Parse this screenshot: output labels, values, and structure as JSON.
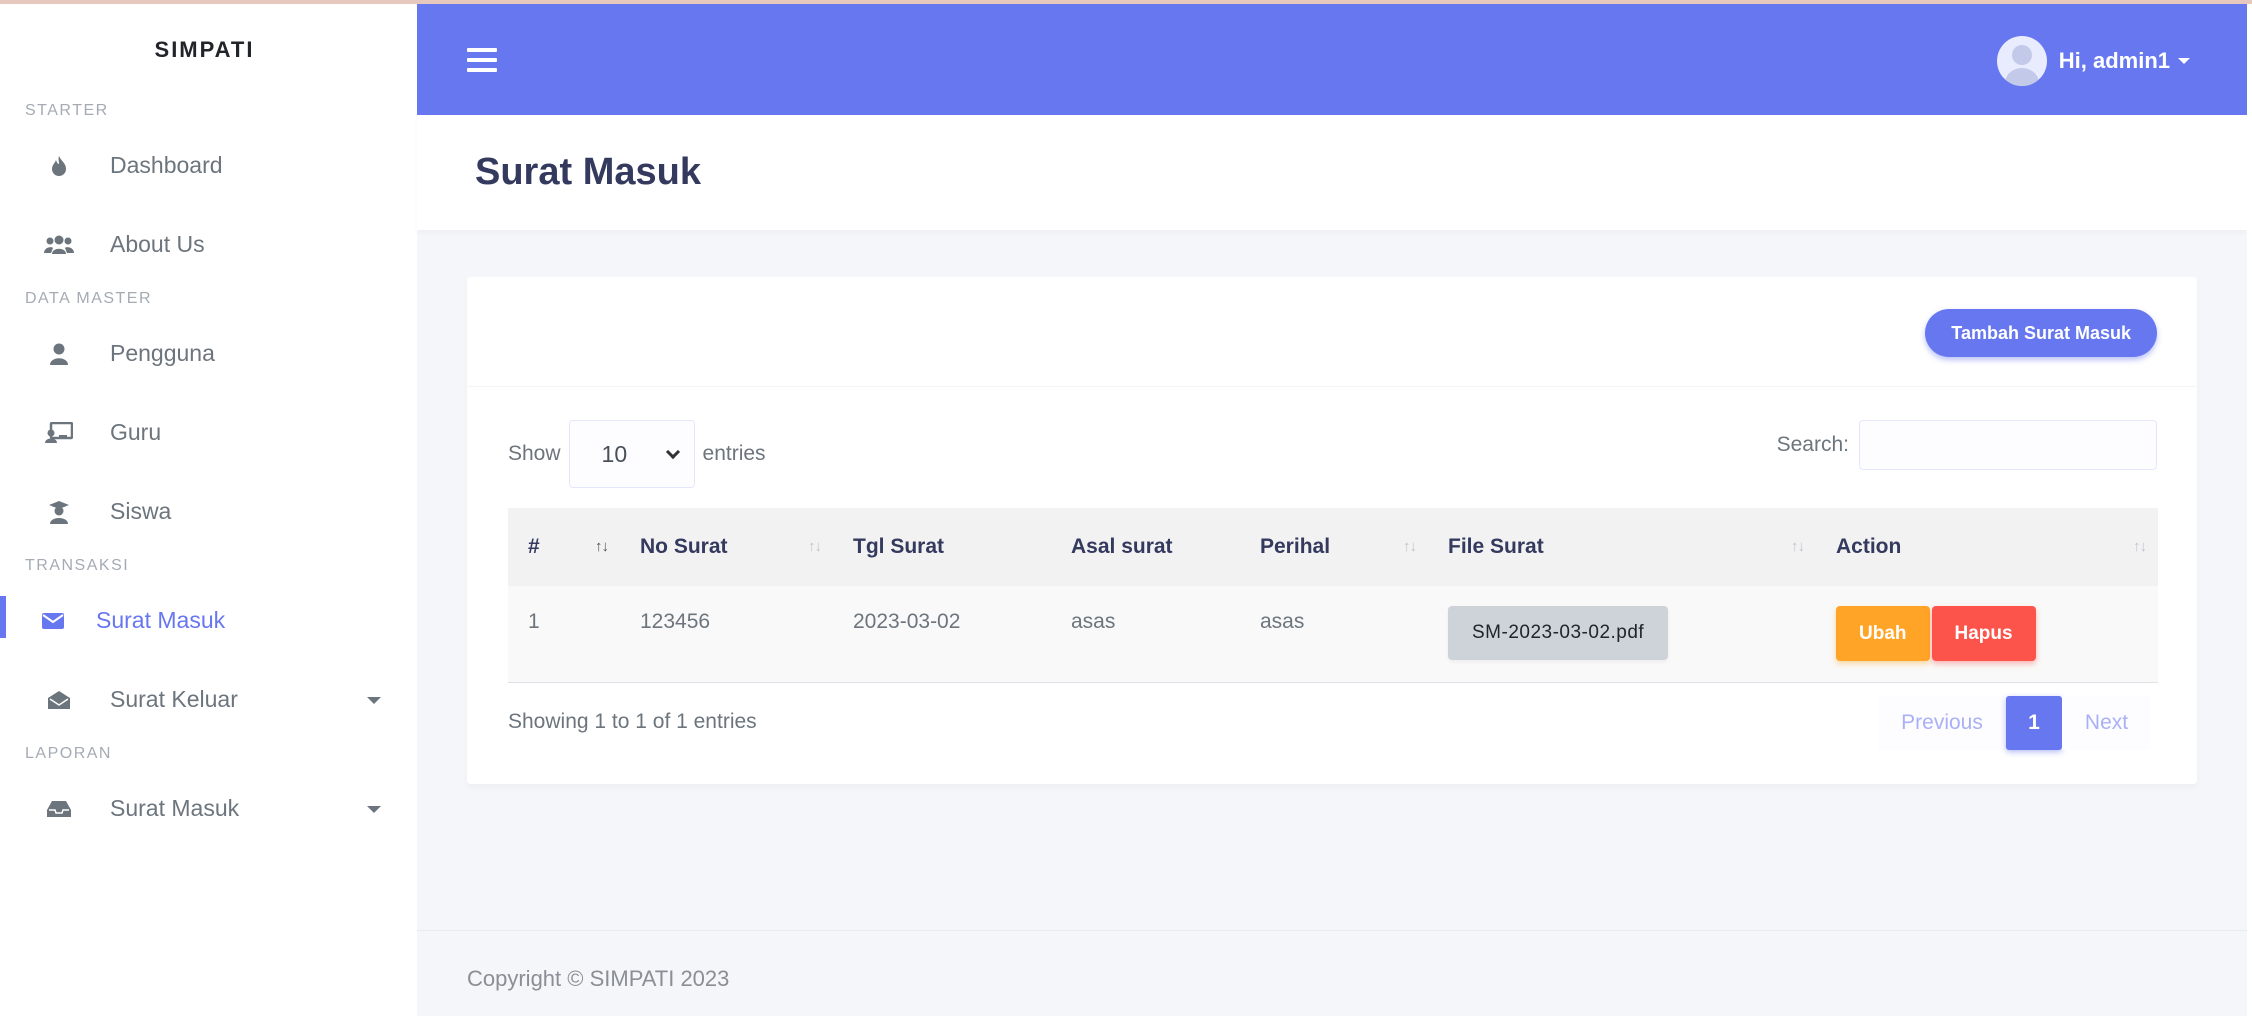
{
  "brand": "SIMPATI",
  "sidebar": {
    "headers": [
      "STARTER",
      "DATA MASTER",
      "TRANSAKSI",
      "LAPORAN"
    ],
    "items": [
      {
        "label": "Dashboard",
        "icon": "fire-icon"
      },
      {
        "label": "About Us",
        "icon": "users-icon"
      },
      {
        "label": "Pengguna",
        "icon": "user-icon"
      },
      {
        "label": "Guru",
        "icon": "chalkboard-teacher-icon"
      },
      {
        "label": "Siswa",
        "icon": "graduate-icon"
      },
      {
        "label": "Surat Masuk",
        "icon": "envelope-icon",
        "active": true
      },
      {
        "label": "Surat Keluar",
        "icon": "envelope-open-icon",
        "dropdown": true
      },
      {
        "label": "Surat Masuk",
        "icon": "inbox-icon",
        "dropdown": true
      }
    ]
  },
  "navbar": {
    "user_label": "Hi, admin1"
  },
  "page": {
    "title": "Surat Masuk",
    "add_button": "Tambah Surat Masuk"
  },
  "table_controls": {
    "show_label": "Show",
    "entries_value": "10",
    "entries_label": "entries",
    "search_label": "Search:"
  },
  "table": {
    "headers": [
      "#",
      "No Surat",
      "Tgl Surat",
      "Asal surat",
      "Perihal",
      "File Surat",
      "Action"
    ],
    "rows": [
      {
        "no": "1",
        "no_surat": "123456",
        "tgl_surat": "2023-03-02",
        "asal_surat": "asas",
        "perihal": "asas",
        "file": "SM-2023-03-02.pdf",
        "edit": "Ubah",
        "delete": "Hapus"
      }
    ]
  },
  "pagination": {
    "info": "Showing 1 to 1 of 1 entries",
    "previous": "Previous",
    "current": "1",
    "next": "Next"
  },
  "footer": {
    "copyright": "Copyright © SIMPATI 2023"
  },
  "colors": {
    "primary": "#6777ef",
    "warning": "#ffa426",
    "danger": "#fc544b"
  }
}
